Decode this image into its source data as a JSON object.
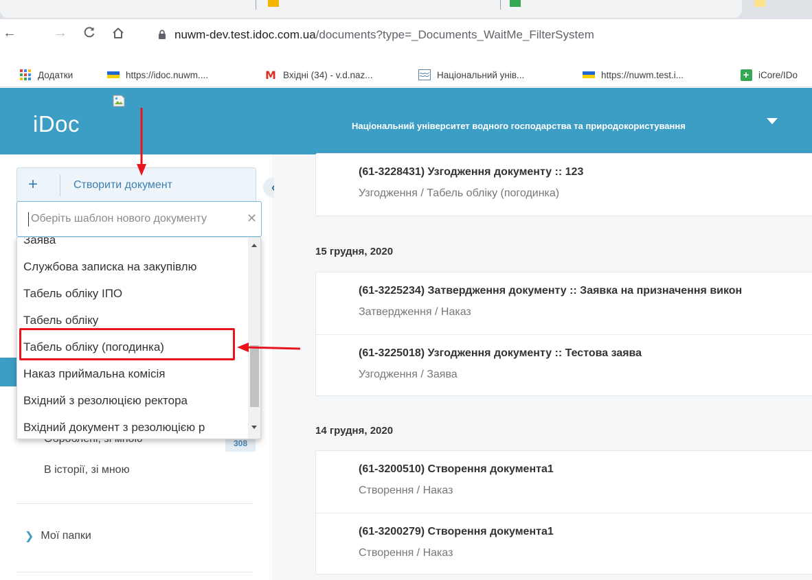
{
  "browser": {
    "url_host": "nuwm-dev.test.idoc.com.ua",
    "url_path": "/documents?type=_Documents_WaitMe_FilterSystem",
    "bookmarks": [
      {
        "label": "Додатки",
        "icon": "apps-grid-icon"
      },
      {
        "label": "https://idoc.nuwm....",
        "icon": "ukraine-flag-icon"
      },
      {
        "label": "Вхідні (34) - v.d.naz...",
        "icon": "gmail-icon"
      },
      {
        "label": "Національний унів...",
        "icon": "university-logo-icon"
      },
      {
        "label": "https://nuwm.test.i...",
        "icon": "ukraine-flag-icon"
      },
      {
        "label": "iCore/IDo",
        "icon": "google-sheets-icon"
      }
    ]
  },
  "header": {
    "logo": "iDoc",
    "org_name": "Національний університет водного господарства та природокористування",
    "color": "#3c9ec4"
  },
  "sidebar": {
    "create_label": "Створити документ",
    "template_placeholder": "Оберіть шаблон нового документу",
    "folders": [
      {
        "label": "Оброблені, зі мною",
        "count": "308"
      },
      {
        "label": "В історії, зі мною"
      }
    ],
    "my_folders_label": "Мої папки"
  },
  "dropdown": {
    "options": [
      "Заява",
      "Службова записка на закупівлю",
      "Табель обліку ІПО",
      "Табель обліку",
      "Табель обліку (погодинка)",
      "Наказ приймальна комісія",
      "Вхідний з резолюцією ректора",
      "Вхідний документ з резолюцією р"
    ],
    "highlighted": "Табель обліку (погодинка)",
    "highlight_color": "#e8141b"
  },
  "main": {
    "groups": [
      {
        "date": "",
        "items": [
          {
            "title": "(61-3228431) Узгодження документу :: 123",
            "subtitle": "Узгодження / Табель обліку (погодинка)"
          }
        ]
      },
      {
        "date": "15 грудня, 2020",
        "items": [
          {
            "title": "(61-3225234) Затвердження документу :: Заявка на призначення викон",
            "subtitle": "Затвердження / Наказ"
          },
          {
            "title": "(61-3225018) Узгодження документу :: Тестова заява",
            "subtitle": "Узгодження / Заява"
          }
        ]
      },
      {
        "date": "14 грудня, 2020",
        "items": [
          {
            "title": "(61-3200510) Створення документа1",
            "subtitle": "Створення / Наказ"
          },
          {
            "title": "(61-3200279) Створення документа1",
            "subtitle": "Створення / Наказ"
          }
        ]
      }
    ]
  }
}
